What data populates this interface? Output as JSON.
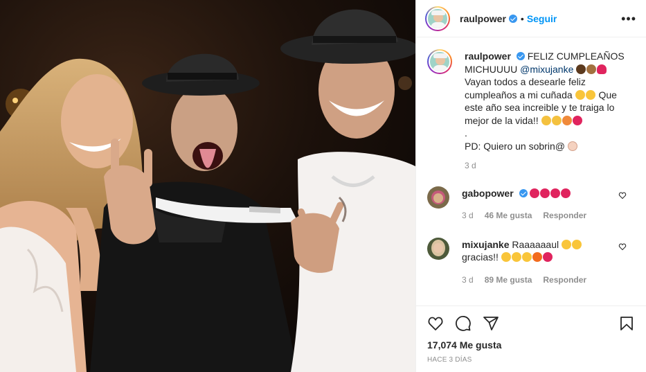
{
  "post": {
    "author": "raulpower",
    "follow_label": "Seguir",
    "separator": "•",
    "more_label": "•••"
  },
  "caption": {
    "username": "raulpower",
    "text_1": "FELIZ CUMPLEAÑOS MICHUUUU",
    "mention": "@mixujanke",
    "text_2": "Vayan todos a desearle feliz cumpleaños a mi cuñada",
    "text_3": "Que este año sea increible y te traiga lo mejor de la vida!!",
    "text_4": ".",
    "text_5": "PD: Quiero un sobrin@",
    "time": "3 d"
  },
  "comments": [
    {
      "username": "gabopower",
      "text": "",
      "time": "3 d",
      "likes": "46 Me gusta",
      "reply": "Responder"
    },
    {
      "username": "mixujanke",
      "text": "Raaaaaaul",
      "text_b": "gracias!!",
      "time": "3 d",
      "likes": "89 Me gusta",
      "reply": "Responder"
    }
  ],
  "footer": {
    "likes": "17,074 Me gusta",
    "posted": "HACE 3 DÍAS"
  },
  "icons": [
    "heart-icon",
    "comment-icon",
    "share-icon",
    "bookmark-icon",
    "verified-icon",
    "more-options-icon"
  ],
  "colors": {
    "link": "#0095f6",
    "verified": "#3897f0",
    "heart": "#ed4956",
    "muted": "#8e8e8e"
  }
}
